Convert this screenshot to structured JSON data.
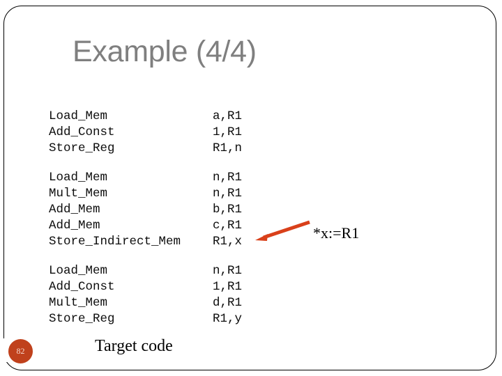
{
  "slide": {
    "title": "Example (4/4)",
    "caption": "Target code",
    "page_number": "82",
    "title_color": "#7f7f7f",
    "accent_color": "#c0411c",
    "background_color": "#ffffff",
    "border_color": "#000000"
  },
  "code": {
    "blocks": [
      {
        "lines": [
          {
            "op": "Load_Mem",
            "args": "a,R1"
          },
          {
            "op": "Add_Const",
            "args": "1,R1"
          },
          {
            "op": "Store_Reg",
            "args": "R1,n"
          }
        ]
      },
      {
        "lines": [
          {
            "op": "Load_Mem",
            "args": "n,R1"
          },
          {
            "op": "Mult_Mem",
            "args": "n,R1"
          },
          {
            "op": "Add_Mem",
            "args": "b,R1"
          },
          {
            "op": "Add_Mem",
            "args": "c,R1"
          },
          {
            "op": "Store_Indirect_Mem",
            "args": "R1,x"
          }
        ]
      },
      {
        "lines": [
          {
            "op": "Load_Mem",
            "args": "n,R1"
          },
          {
            "op": "Add_Const",
            "args": "1,R1"
          },
          {
            "op": "Mult_Mem",
            "args": "d,R1"
          },
          {
            "op": "Store_Reg",
            "args": "R1,y"
          }
        ]
      }
    ]
  },
  "annotation": {
    "label": "*x:=R1",
    "arrow_color": "#d9401a",
    "arrow_points_to": "Store_Indirect_Mem R1,x"
  }
}
